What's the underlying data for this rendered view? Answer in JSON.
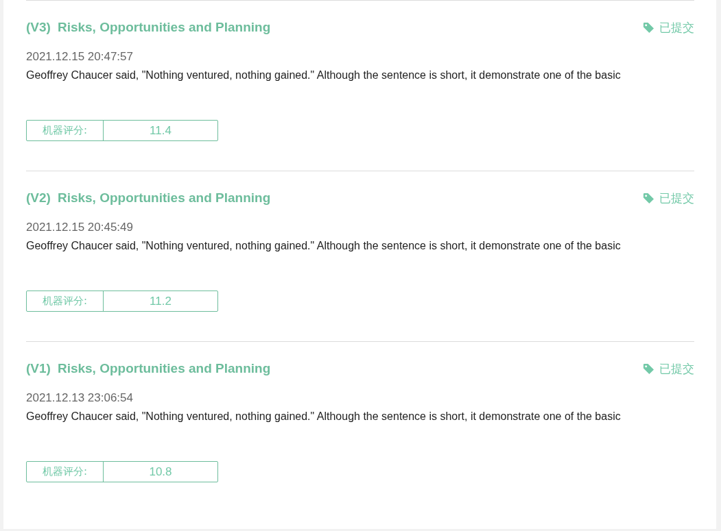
{
  "entries": [
    {
      "version": "(V3)",
      "title": "Risks, Opportunities and Planning",
      "status": "已提交",
      "date": "2021.12.15 20:47:57",
      "excerpt": "Geoffrey Chaucer said, \"Nothing ventured, nothing gained.\" Although the sentence is short, it demonstrate one of the basic",
      "score_label": "机器评分:",
      "score": "11.4"
    },
    {
      "version": "(V2)",
      "title": "Risks, Opportunities and Planning",
      "status": "已提交",
      "date": "2021.12.15 20:45:49",
      "excerpt": "Geoffrey Chaucer said, \"Nothing ventured, nothing gained.\" Although the sentence is short, it demonstrate one of the basic",
      "score_label": "机器评分:",
      "score": "11.2"
    },
    {
      "version": "(V1)",
      "title": "Risks, Opportunities and Planning",
      "status": "已提交",
      "date": "2021.12.13 23:06:54",
      "excerpt": "Geoffrey Chaucer said, \"Nothing ventured, nothing gained.\" Although the sentence is short, it demonstrate one of the basic",
      "score_label": "机器评分:",
      "score": "10.8"
    }
  ]
}
